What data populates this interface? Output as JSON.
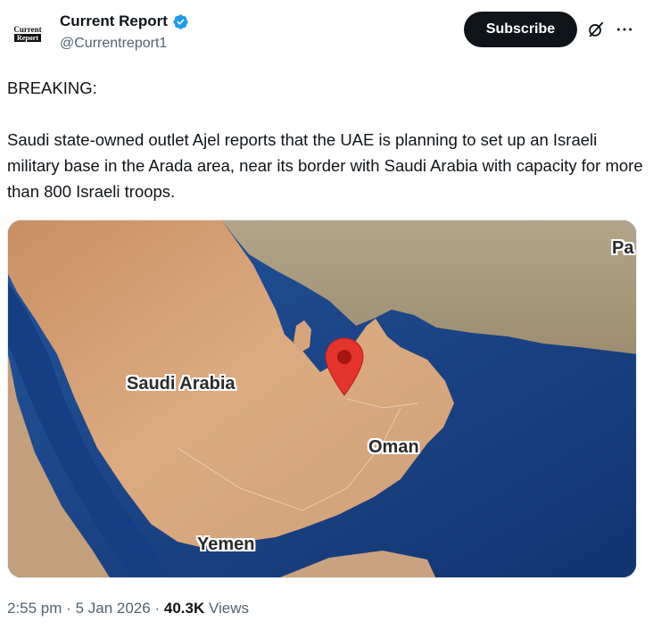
{
  "author": {
    "avatar_line1": "Current",
    "avatar_line2": "Report",
    "display_name": "Current Report",
    "handle": "@Currentreport1",
    "verified": true
  },
  "actions": {
    "subscribe_label": "Subscribe",
    "grok_icon": "grok-slash-circle-icon",
    "more_icon": "more-horizontal-icon"
  },
  "tweet": {
    "heading": "BREAKING:",
    "body": "Saudi state-owned outlet Ajel reports that the UAE is planning to set up an Israeli military base in the Arada area, near its border with Saudi Arabia with capacity for more than 800 Israeli troops."
  },
  "map": {
    "labels": {
      "saudi": "Saudi Arabia",
      "oman": "Oman",
      "yemen": "Yemen",
      "pak": "Pa"
    },
    "pin_color": "#e5342b",
    "sea_color": "#1a3f86",
    "land_color": "#d9a77a"
  },
  "meta": {
    "time": "2:55 pm",
    "sep1": "·",
    "date": "5 Jan 2026",
    "sep2": "·",
    "views_count": "40.3K",
    "views_label": "Views"
  }
}
